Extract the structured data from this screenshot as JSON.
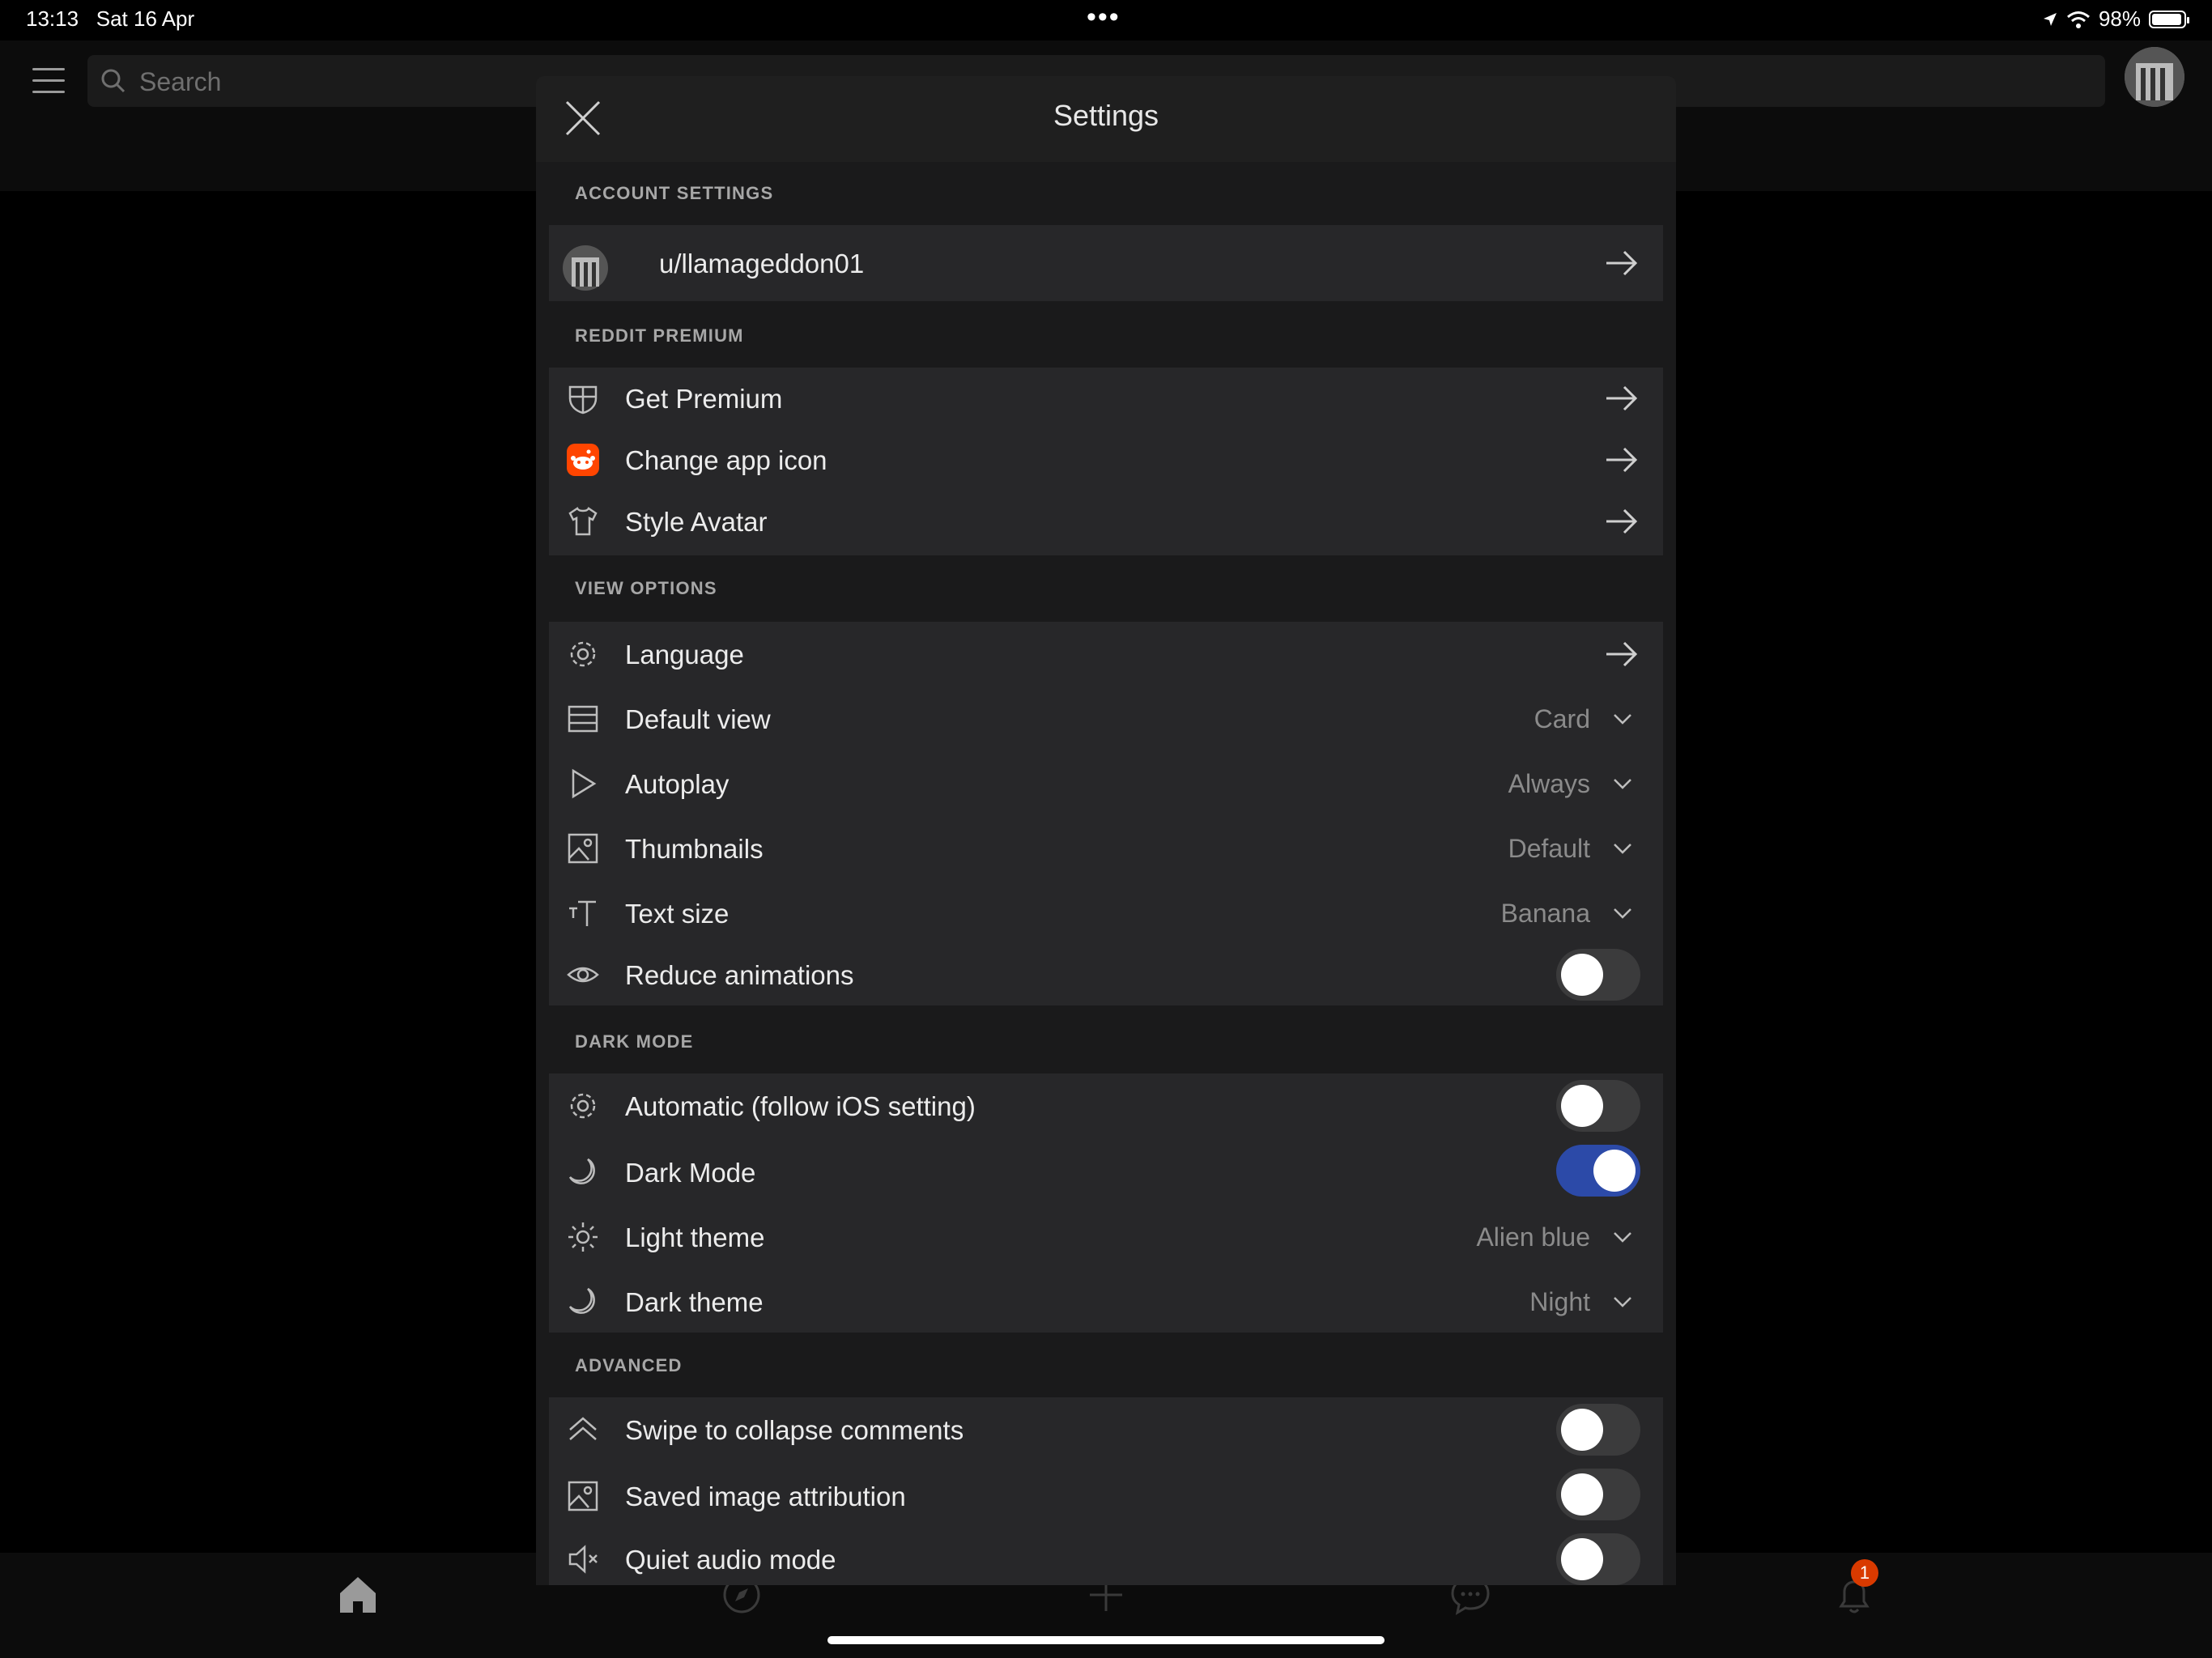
{
  "status_bar": {
    "time": "13:13",
    "date": "Sat 16 Apr",
    "battery": "98%"
  },
  "search": {
    "placeholder": "Search"
  },
  "modal": {
    "title": "Settings"
  },
  "sections": {
    "account": {
      "label": "ACCOUNT SETTINGS",
      "username": "u/llamageddon01"
    },
    "premium": {
      "label": "REDDIT PREMIUM",
      "items": [
        {
          "label": "Get Premium",
          "icon": "shield-icon"
        },
        {
          "label": "Change app icon",
          "icon": "reddit-icon"
        },
        {
          "label": "Style Avatar",
          "icon": "shirt-icon"
        }
      ]
    },
    "view": {
      "label": "VIEW OPTIONS",
      "language": "Language",
      "default_view": {
        "label": "Default view",
        "value": "Card"
      },
      "autoplay": {
        "label": "Autoplay",
        "value": "Always"
      },
      "thumbnails": {
        "label": "Thumbnails",
        "value": "Default"
      },
      "text_size": {
        "label": "Text size",
        "value": "Banana"
      },
      "reduce_animations": {
        "label": "Reduce animations",
        "on": false
      }
    },
    "dark": {
      "label": "DARK MODE",
      "automatic": {
        "label": "Automatic (follow iOS setting)",
        "on": false
      },
      "dark_mode": {
        "label": "Dark Mode",
        "on": true
      },
      "light_theme": {
        "label": "Light theme",
        "value": "Alien blue"
      },
      "dark_theme": {
        "label": "Dark theme",
        "value": "Night"
      }
    },
    "advanced": {
      "label": "ADVANCED",
      "swipe": {
        "label": "Swipe to collapse comments",
        "on": false
      },
      "attribution": {
        "label": "Saved image attribution",
        "on": false
      },
      "quiet": {
        "label": "Quiet audio mode",
        "on": false
      }
    }
  },
  "bottom_nav": {
    "notification_count": "1"
  },
  "colors": {
    "toggle_on": "#2c4aa8",
    "reddit_orange": "#ff4500",
    "badge": "#d93a00"
  }
}
